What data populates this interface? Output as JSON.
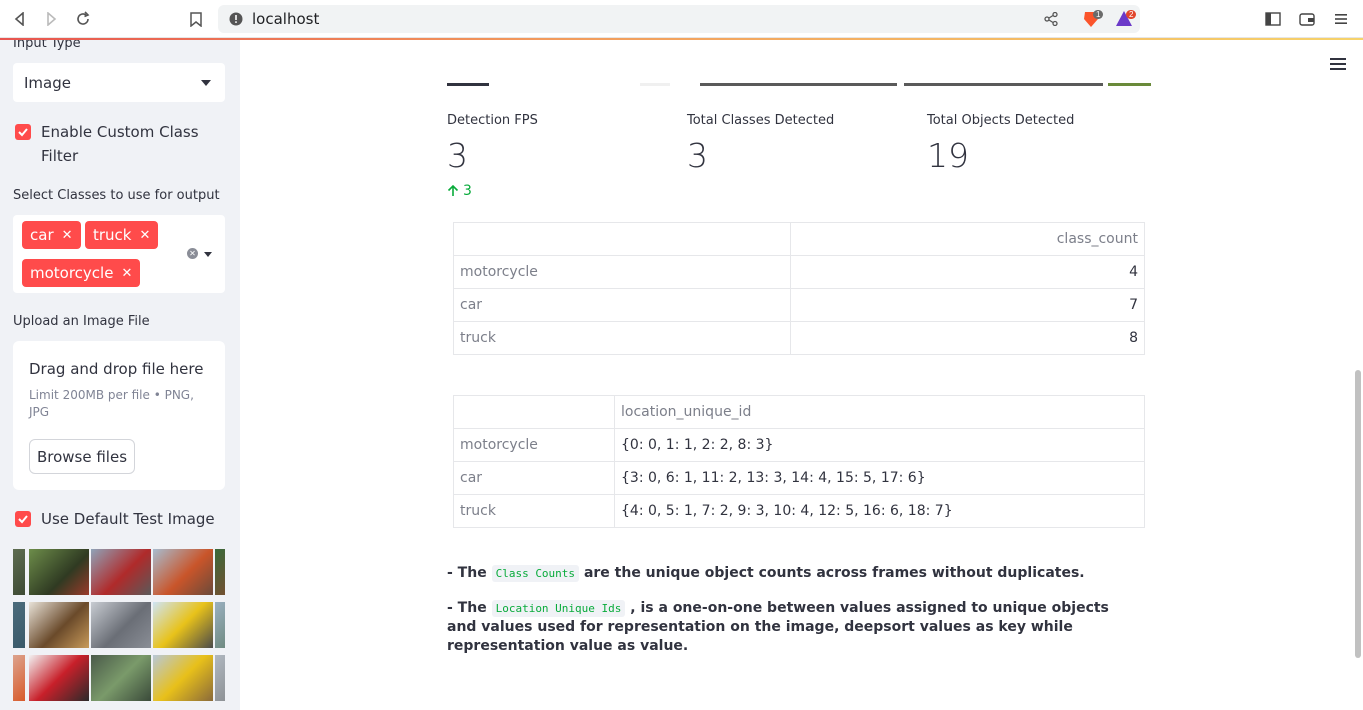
{
  "browser": {
    "url": "localhost",
    "brave_badge": "1",
    "rewards_badge": "2"
  },
  "sidebar": {
    "input_type_label": "Input Type",
    "input_type_value": "Image",
    "custom_filter_label": "Enable Custom Class Filter",
    "select_classes_label": "Select Classes to use for output",
    "selected_classes": [
      "car",
      "truck",
      "motorcycle"
    ],
    "upload_label": "Upload an Image File",
    "upload_title": "Drag and drop file here",
    "upload_limit": "Limit 200MB per file • PNG, JPG",
    "browse_label": "Browse files",
    "default_test_label": "Use Default Test Image"
  },
  "metrics": [
    {
      "label": "Detection FPS",
      "value": "3",
      "delta": "3"
    },
    {
      "label": "Total Classes Detected",
      "value": "3"
    },
    {
      "label": "Total Objects Detected",
      "value": "19"
    }
  ],
  "class_counts": {
    "header": "class_count",
    "rows": [
      {
        "name": "motorcycle",
        "count": "4"
      },
      {
        "name": "car",
        "count": "7"
      },
      {
        "name": "truck",
        "count": "8"
      }
    ]
  },
  "unique_ids": {
    "header": "location_unique_id",
    "rows": [
      {
        "name": "motorcycle",
        "value": "{0: 0, 1: 1, 2: 2, 8: 3}"
      },
      {
        "name": "car",
        "value": "{3: 0, 6: 1, 11: 2, 13: 3, 14: 4, 15: 5, 17: 6}"
      },
      {
        "name": "truck",
        "value": "{4: 0, 5: 1, 7: 2, 9: 3, 10: 4, 12: 5, 16: 6, 18: 7}"
      }
    ]
  },
  "notes": {
    "n1_prefix": "- The",
    "n1_code": "Class Counts",
    "n1_suffix": "are the unique object counts across frames without duplicates.",
    "n2_prefix": "- The",
    "n2_code": "Location Unique Ids",
    "n2_suffix": ", is a one-on-one between values assigned to unique objects and values used for representation on the image, deepsort values as key while representation value as value."
  },
  "colors": {
    "accent": "#ff4b4b",
    "delta_green": "#09ab3b",
    "sidebar_bg": "#f0f2f6"
  }
}
